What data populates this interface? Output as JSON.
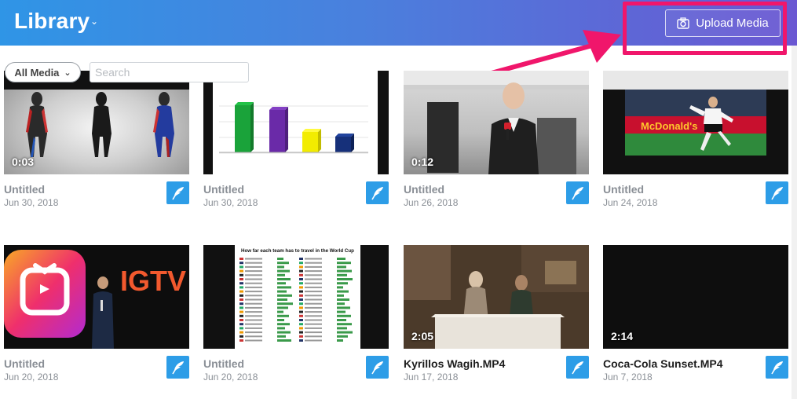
{
  "header": {
    "title": "Library",
    "upload_label": "Upload Media"
  },
  "toolbar": {
    "filter_label": "All Media",
    "search_placeholder": "Search"
  },
  "colors": {
    "header_gradient_start": "#2f95e6",
    "header_gradient_end": "#6a57d2",
    "highlight": "#f0166b",
    "edit_button": "#2d9de7"
  },
  "media": [
    {
      "title": "Untitled",
      "date": "Jun 30, 2018",
      "duration": "0:03"
    },
    {
      "title": "Untitled",
      "date": "Jun 30, 2018",
      "duration": ""
    },
    {
      "title": "Untitled",
      "date": "Jun 26, 2018",
      "duration": "0:12"
    },
    {
      "title": "Untitled",
      "date": "Jun 24, 2018",
      "duration": ""
    },
    {
      "title": "Untitled",
      "date": "Jun 20, 2018",
      "duration": ""
    },
    {
      "title": "Untitled",
      "date": "Jun 20, 2018",
      "duration": ""
    },
    {
      "title": "Kyrillos Wagih.MP4",
      "date": "Jun 17, 2018",
      "duration": "2:05"
    },
    {
      "title": "Coca-Cola Sunset.MP4",
      "date": "Jun 7, 2018",
      "duration": "2:14"
    }
  ],
  "thumb_text": {
    "igtv": "IGTV",
    "worldcup_title": "How far each team has to travel in the World Cup",
    "mcdonalds": "McDonald's"
  }
}
